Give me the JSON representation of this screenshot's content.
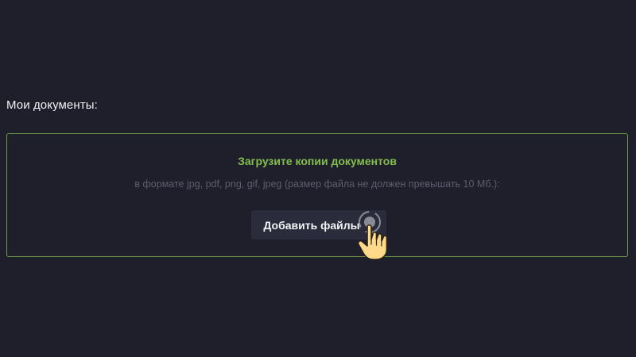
{
  "documents": {
    "title": "Мои документы:",
    "upload": {
      "heading": "Загрузите копии документов",
      "hint": "в формате jpg, pdf, png, gif, jpeg (размер файла не должен превышать 10 Мб.):",
      "button_label": "Добавить файлы"
    }
  },
  "icons": {
    "pointer": "hand-pointer-icon"
  },
  "colors": {
    "background": "#1e1f2b",
    "accent_green": "#83be4e",
    "border_green": "#6f9a48",
    "button_bg": "#2a2c3b",
    "hint_text": "#5c5e6e"
  }
}
